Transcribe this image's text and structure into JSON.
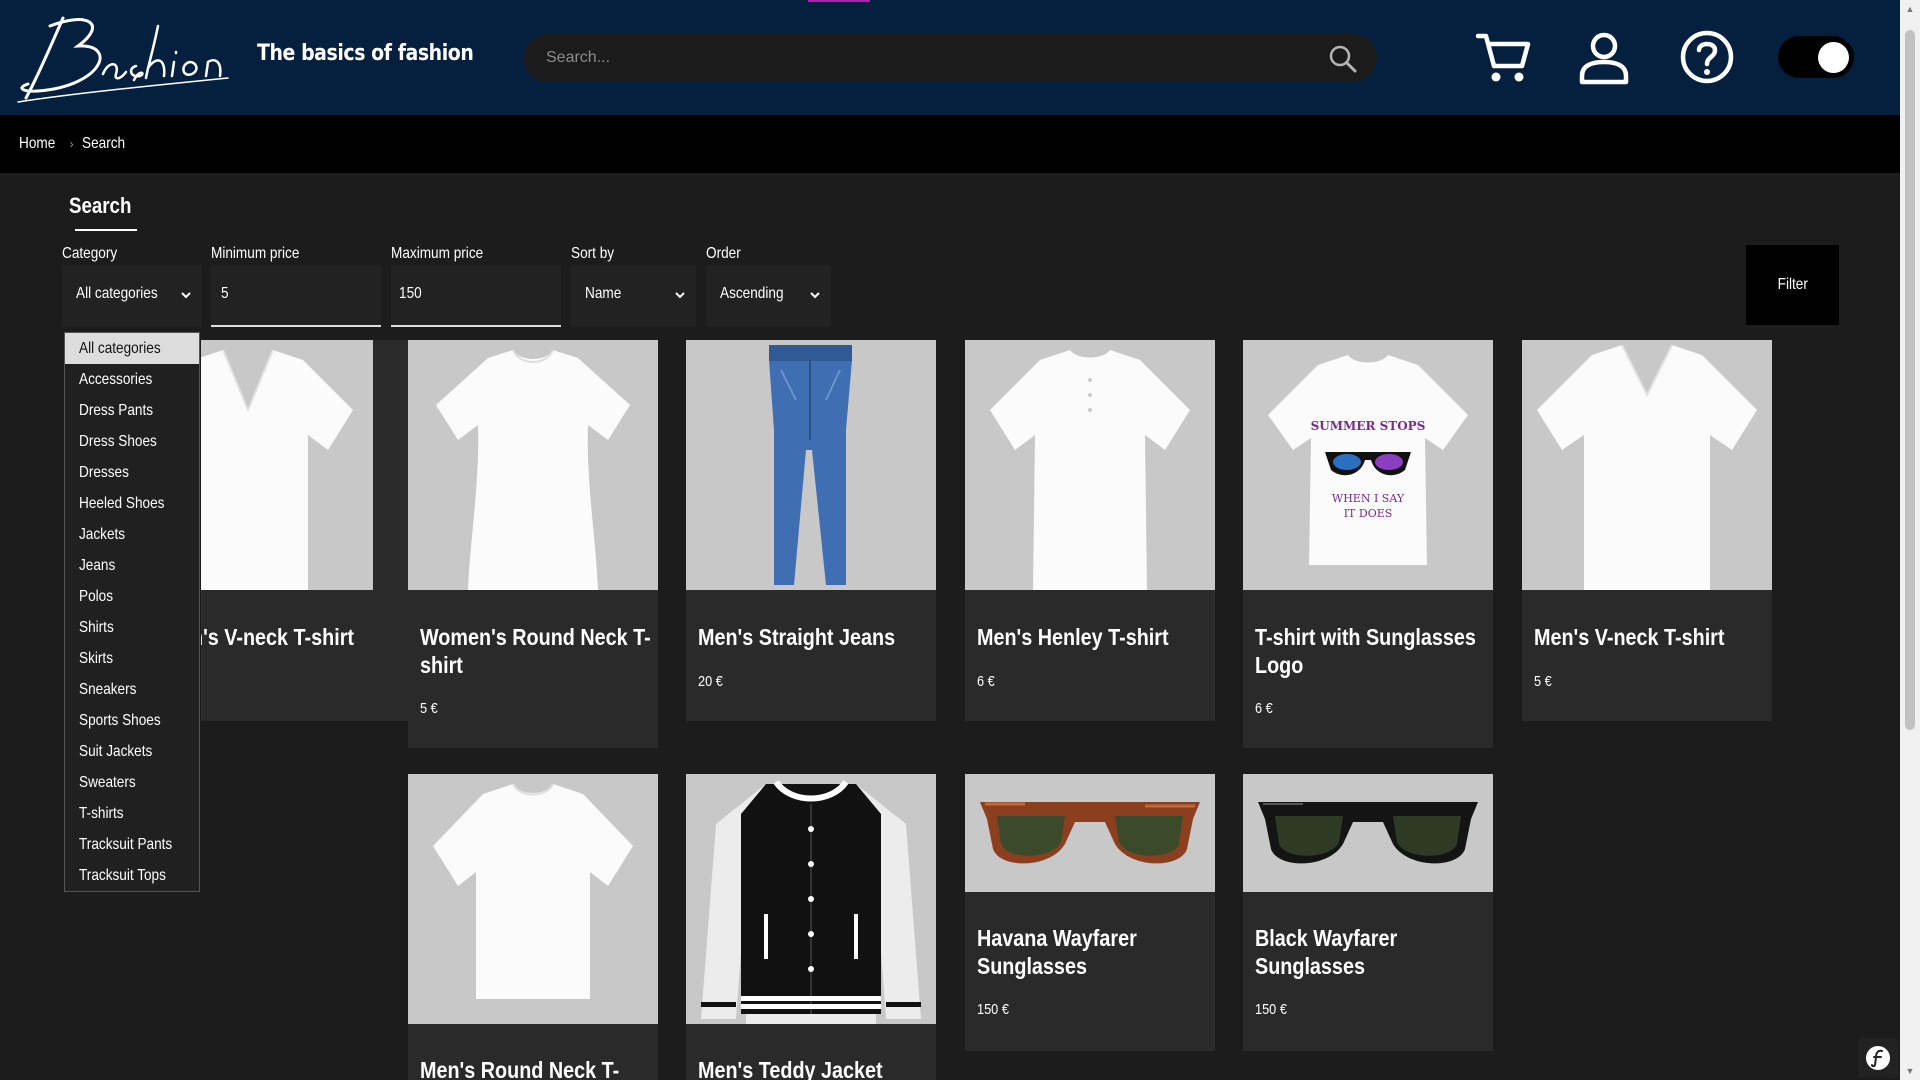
{
  "header": {
    "logo_text": "Bashion",
    "tagline": "The basics of fashion",
    "search_placeholder": "Search...",
    "icons": [
      "search-icon",
      "cart-icon",
      "user-icon",
      "help-icon",
      "theme-toggle"
    ]
  },
  "breadcrumb": {
    "home": "Home",
    "current": "Search"
  },
  "page": {
    "title": "Search"
  },
  "filters": {
    "category_label": "Category",
    "category_value": "All categories",
    "min_label": "Minimum price",
    "min_value": "5",
    "max_label": "Maximum price",
    "max_value": "150",
    "sort_label": "Sort by",
    "sort_value": "Name",
    "order_label": "Order",
    "order_value": "Ascending",
    "filter_button": "Filter"
  },
  "category_options": [
    "All categories",
    "Accessories",
    "Dress Pants",
    "Dress Shoes",
    "Dresses",
    "Heeled Shoes",
    "Jackets",
    "Jeans",
    "Polos",
    "Shirts",
    "Skirts",
    "Sneakers",
    "Sports Shoes",
    "Suit Jackets",
    "Sweaters",
    "T-shirts",
    "Tracksuit Pants",
    "Tracksuit Tops"
  ],
  "products": [
    {
      "name": "Women's V-neck T-shirt",
      "visible_name": "n's V-neck T-shirt",
      "price": ""
    },
    {
      "name": "Women's Round Neck T-shirt",
      "price": "5 €"
    },
    {
      "name": "Men's Straight Jeans",
      "price": "20 €"
    },
    {
      "name": "Men's Henley T-shirt",
      "price": "6 €"
    },
    {
      "name": "T-shirt with Sunglasses Logo",
      "price": "6 €",
      "print_line1": "SUMMER STOPS",
      "print_line2": "WHEN I SAY",
      "print_line3": "IT DOES"
    },
    {
      "name": "Men's V-neck T-shirt",
      "price": "5 €"
    },
    {
      "name": "Men's Round Neck T-shirt",
      "price": ""
    },
    {
      "name": "Men's Teddy Jacket",
      "price": ""
    },
    {
      "name": "Havana Wayfarer Sunglasses",
      "price": "150 €"
    },
    {
      "name": "Black Wayfarer Sunglasses",
      "price": "150 €"
    }
  ],
  "colors": {
    "header_bg": "#05203f",
    "page_bg": "#1c1c1c",
    "card_bg": "#2a2a2a",
    "accent": "#b01fb0"
  }
}
